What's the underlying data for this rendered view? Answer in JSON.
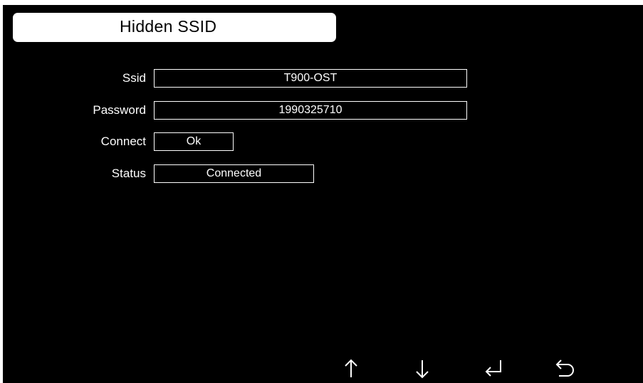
{
  "header": {
    "title": "Hidden SSID"
  },
  "form": {
    "ssid": {
      "label": "Ssid",
      "value": "T900-OST"
    },
    "password": {
      "label": "Password",
      "value": "1990325710"
    },
    "connect": {
      "label": "Connect",
      "button_label": "Ok"
    },
    "status": {
      "label": "Status",
      "value": "Connected"
    }
  },
  "nav": {
    "icons": [
      "arrow-up-icon",
      "arrow-down-icon",
      "enter-icon",
      "back-icon"
    ]
  },
  "colors": {
    "background": "#000000",
    "foreground": "#ffffff"
  }
}
